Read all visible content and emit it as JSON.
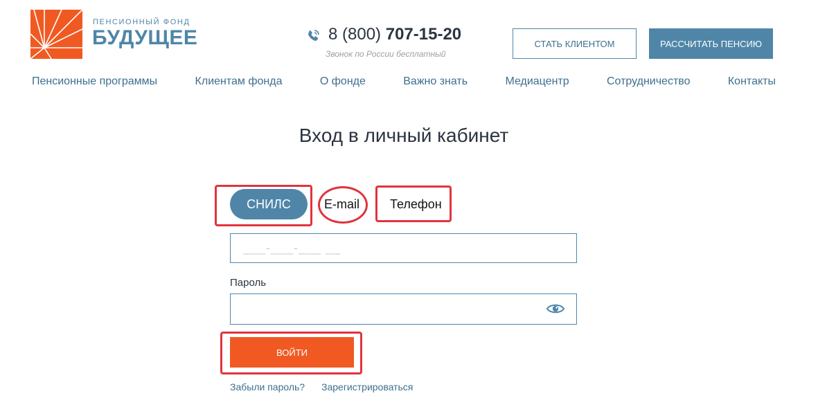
{
  "brand": {
    "small_title": "ПЕНСИОННЫЙ ФОНД",
    "big_title": "БУДУЩЕЕ",
    "color": "#4f86a8",
    "logo_color": "#f05a22"
  },
  "contact": {
    "phone_prefix": "8 (800) ",
    "phone_main": "707-15-20",
    "phone_note": "Звонок по России бесплатный",
    "phone_icon": "phone-icon"
  },
  "header_buttons": {
    "become_client": "СТАТЬ КЛИЕНТОМ",
    "calculate_pension": "РАССЧИТАТЬ ПЕНСИЮ"
  },
  "nav": {
    "items": [
      "Пенсионные программы",
      "Клиентам фонда",
      "О фонде",
      "Важно знать",
      "Медиацентр",
      "Сотрудничество",
      "Контакты"
    ]
  },
  "login": {
    "title": "Вход в личный кабинет",
    "tabs": {
      "snils": "СНИЛС",
      "email": "E-mail",
      "phone": "Телефон",
      "active": "snils"
    },
    "snils_placeholder": "___-___-___ __",
    "password_label": "Пароль",
    "password_value": "",
    "show_password_icon": "eye-icon",
    "submit_label": "ВОЙТИ",
    "forgot_link": "Забыли пароль?",
    "register_link": "Зарегистрироваться"
  },
  "colors": {
    "accent_blue": "#4f86a8",
    "accent_orange": "#f05a22",
    "annotation_red": "#e0343c"
  }
}
